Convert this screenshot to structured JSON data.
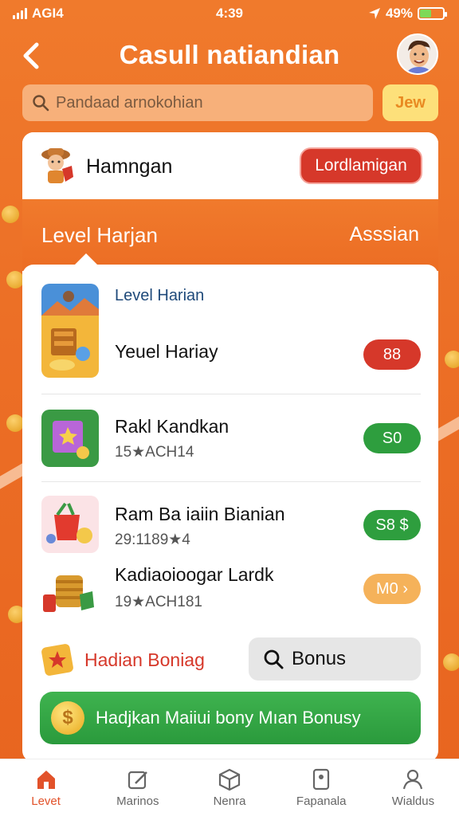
{
  "status_bar": {
    "carrier": "AGI4",
    "time": "4:39",
    "battery": "49%"
  },
  "header": {
    "title": "Casull natiandian",
    "back_icon": "chevron-left-icon"
  },
  "search": {
    "placeholder": "Pandaad arnokohian",
    "join_label": "Jew"
  },
  "user": {
    "name": "Hamngan",
    "challenge_label": "Lordlamigan"
  },
  "band": {
    "title": "Level Harjan",
    "link": "Asssian"
  },
  "list": {
    "section_label": "Level Harian",
    "items": [
      {
        "title": "Yeuel Hariay",
        "subtitle": "",
        "badge": "88",
        "badge_color": "#d6382a"
      },
      {
        "title": "Rakl Kandkan",
        "subtitle": "15★ACH14",
        "badge": "S0",
        "badge_color": "#2e9e3e"
      },
      {
        "title": "Ram Ba iaiin Bianian",
        "subtitle": "29:1189★4",
        "badge": "S8 $",
        "badge_color": "#2e9e3e"
      },
      {
        "title": "Kadiaoioogar Lardk",
        "subtitle": "19★ACH181",
        "badge": "M0 ›",
        "badge_color": "#f5b25a"
      }
    ]
  },
  "bonus_row": {
    "hadian_label": "Hadian Boniag",
    "bonus_label": "Bonus"
  },
  "cta": {
    "label": "Hadjkan Maiiui bony Mıan Bonusy"
  },
  "nav": [
    {
      "label": "Levet",
      "icon": "home-icon",
      "active": true
    },
    {
      "label": "Marinos",
      "icon": "edit-icon",
      "active": false
    },
    {
      "label": "Nenra",
      "icon": "box-icon",
      "active": false
    },
    {
      "label": "Fapanala",
      "icon": "doc-icon",
      "active": false
    },
    {
      "label": "Wialdus",
      "icon": "user-icon",
      "active": false
    }
  ],
  "colors": {
    "accent": "#ec6f26",
    "danger": "#d6382a",
    "success": "#2e9e3e"
  }
}
